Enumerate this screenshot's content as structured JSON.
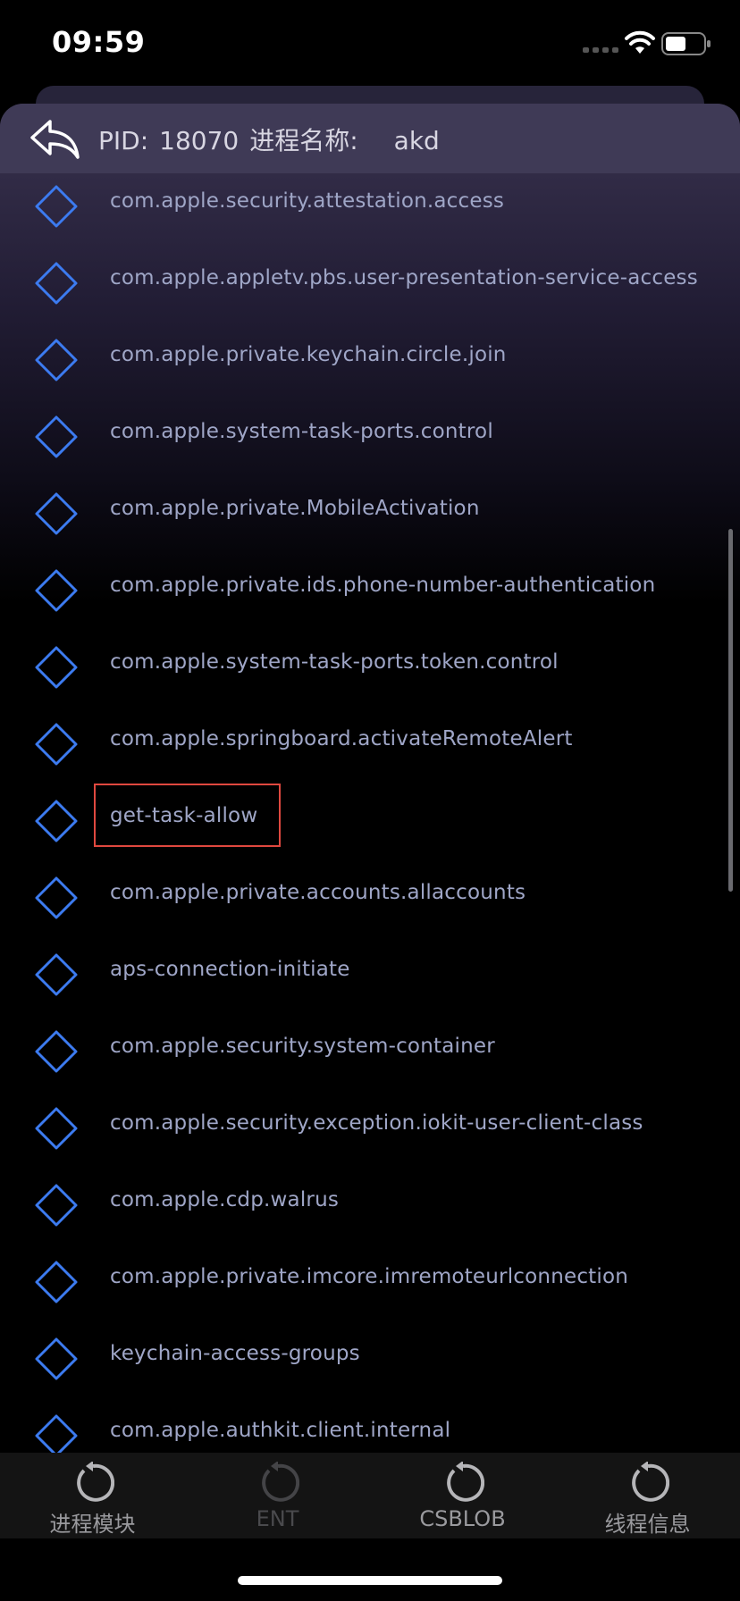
{
  "status_bar": {
    "time": "09:59"
  },
  "header": {
    "pid_label": "PID:",
    "pid_value": "18070",
    "name_label": "进程名称:",
    "name_value": "akd"
  },
  "entitlements": [
    "com.apple.security.attestation.access",
    "com.apple.appletv.pbs.user-presentation-service-access",
    "com.apple.private.keychain.circle.join",
    "com.apple.system-task-ports.control",
    "com.apple.private.MobileActivation",
    "com.apple.private.ids.phone-number-authentication",
    "com.apple.system-task-ports.token.control",
    "com.apple.springboard.activateRemoteAlert",
    "get-task-allow",
    "com.apple.private.accounts.allaccounts",
    "aps-connection-initiate",
    "com.apple.security.system-container",
    "com.apple.security.exception.iokit-user-client-class",
    "com.apple.cdp.walrus",
    "com.apple.private.imcore.imremoteurlconnection",
    "keychain-access-groups",
    "com.apple.authkit.client.internal"
  ],
  "highlighted_entry": "get-task-allow",
  "tabs": [
    {
      "label": "进程模块",
      "icon": "refresh-icon",
      "enabled": true
    },
    {
      "label": "ENT",
      "icon": "refresh-icon",
      "enabled": false
    },
    {
      "label": "CSBLOB",
      "icon": "refresh-icon",
      "enabled": true
    },
    {
      "label": "线程信息",
      "icon": "refresh-icon",
      "enabled": true
    }
  ],
  "colors": {
    "diamond": "#3c7bf0",
    "highlight_box": "#e0483f",
    "entry_text": "#9fa6c7"
  }
}
